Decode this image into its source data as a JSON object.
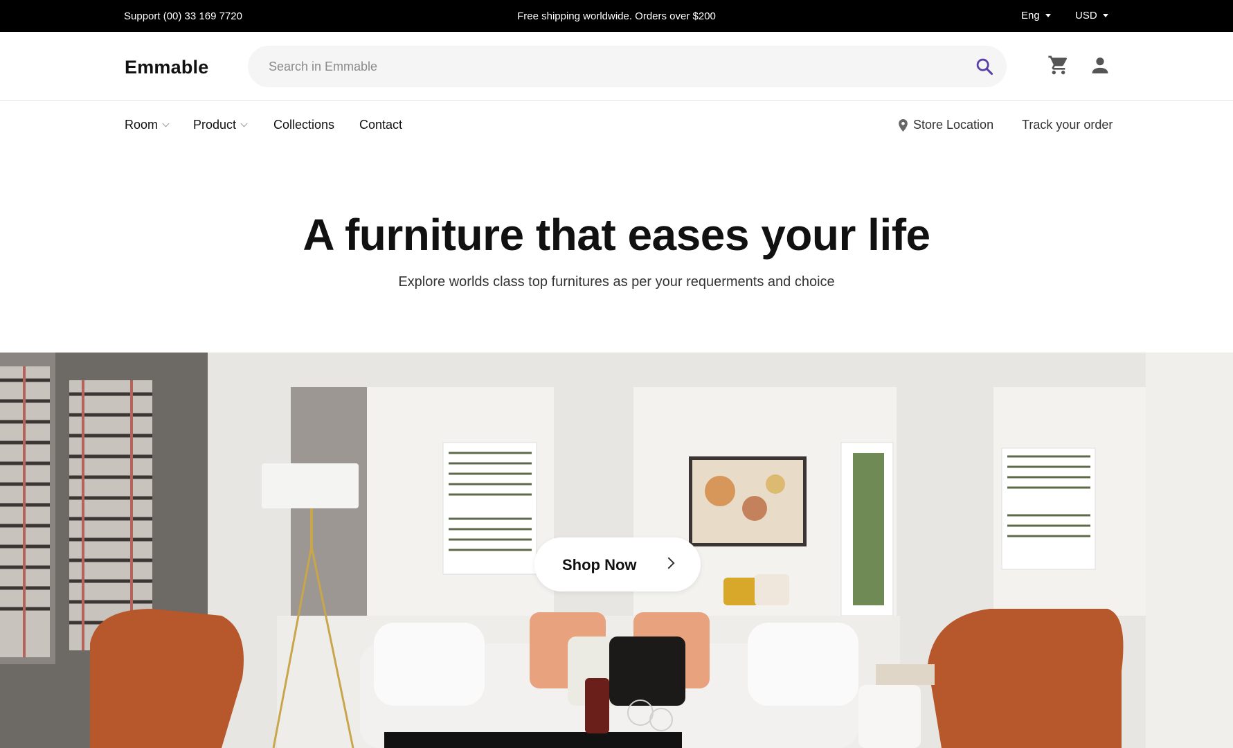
{
  "topbar": {
    "support": "Support (00) 33 169 7720",
    "promo": "Free shipping worldwide. Orders over $200",
    "language": "Eng",
    "currency": "USD"
  },
  "header": {
    "logo": "Emmable",
    "search_placeholder": "Search in Emmable",
    "icons": [
      "search-icon",
      "cart-icon",
      "user-icon"
    ]
  },
  "nav": {
    "items": [
      {
        "label": "Room",
        "dropdown": true
      },
      {
        "label": "Product",
        "dropdown": true
      },
      {
        "label": "Collections",
        "dropdown": false
      },
      {
        "label": "Contact",
        "dropdown": false
      }
    ],
    "store_location": "Store Location",
    "track_order": "Track your order"
  },
  "hero": {
    "title": "A furniture that eases your life",
    "subtitle": "Explore worlds class top furnitures as per your requerments and choice",
    "cta": "Shop Now"
  },
  "colors": {
    "topbar_bg": "#000000",
    "search_icon": "#5b3fa8",
    "search_bg": "#f5f5f5"
  }
}
